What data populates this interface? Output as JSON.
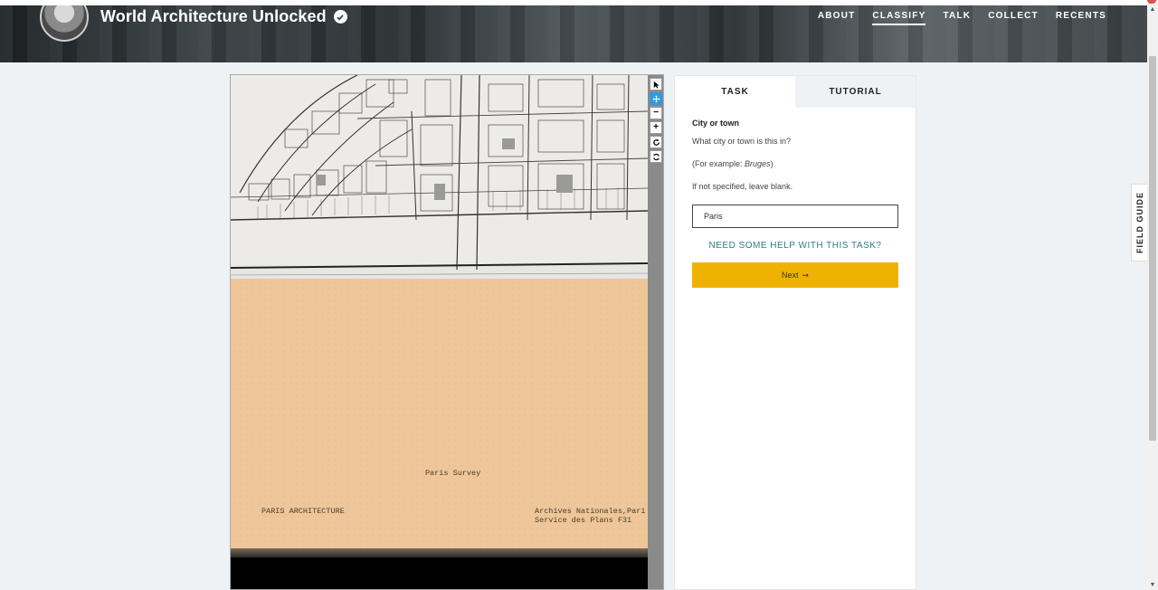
{
  "header": {
    "project_title": "World Architecture Unlocked",
    "nav": [
      "ABOUT",
      "CLASSIFY",
      "TALK",
      "COLLECT",
      "RECENTS"
    ],
    "active_nav": "CLASSIFY"
  },
  "viewer": {
    "paper_title": "Paris Survey",
    "paper_left_label": "PARIS ARCHITECTURE",
    "paper_right_label_1": "Archives Nationales,Pari",
    "paper_right_label_2": "Service des Plans F31",
    "tools": [
      "pointer-icon",
      "move-icon",
      "zoom-out-icon",
      "zoom-in-icon",
      "rotate-icon",
      "reset-icon"
    ],
    "tool_glyphs": {
      "zoom_out": "−",
      "zoom_in": "+"
    }
  },
  "task": {
    "tabs": [
      "TASK",
      "TUTORIAL"
    ],
    "title": "City or town",
    "question": "What city or town is this in?",
    "example_prefix": "(For example: ",
    "example_value": "Bruges",
    "example_suffix": ")",
    "instruction": "If not specified, leave blank.",
    "answer_value": "Paris",
    "help_link": "NEED SOME HELP WITH THIS TASK?",
    "next_label": "Next",
    "next_arrow": "➞"
  },
  "field_guide": {
    "label": "FIELD GUIDE"
  },
  "scrollbar": {
    "up": "▲",
    "down": "▼"
  },
  "colors": {
    "accent": "#f0b200",
    "link": "#2d7e7e",
    "tool_active": "#2f9bdc"
  }
}
